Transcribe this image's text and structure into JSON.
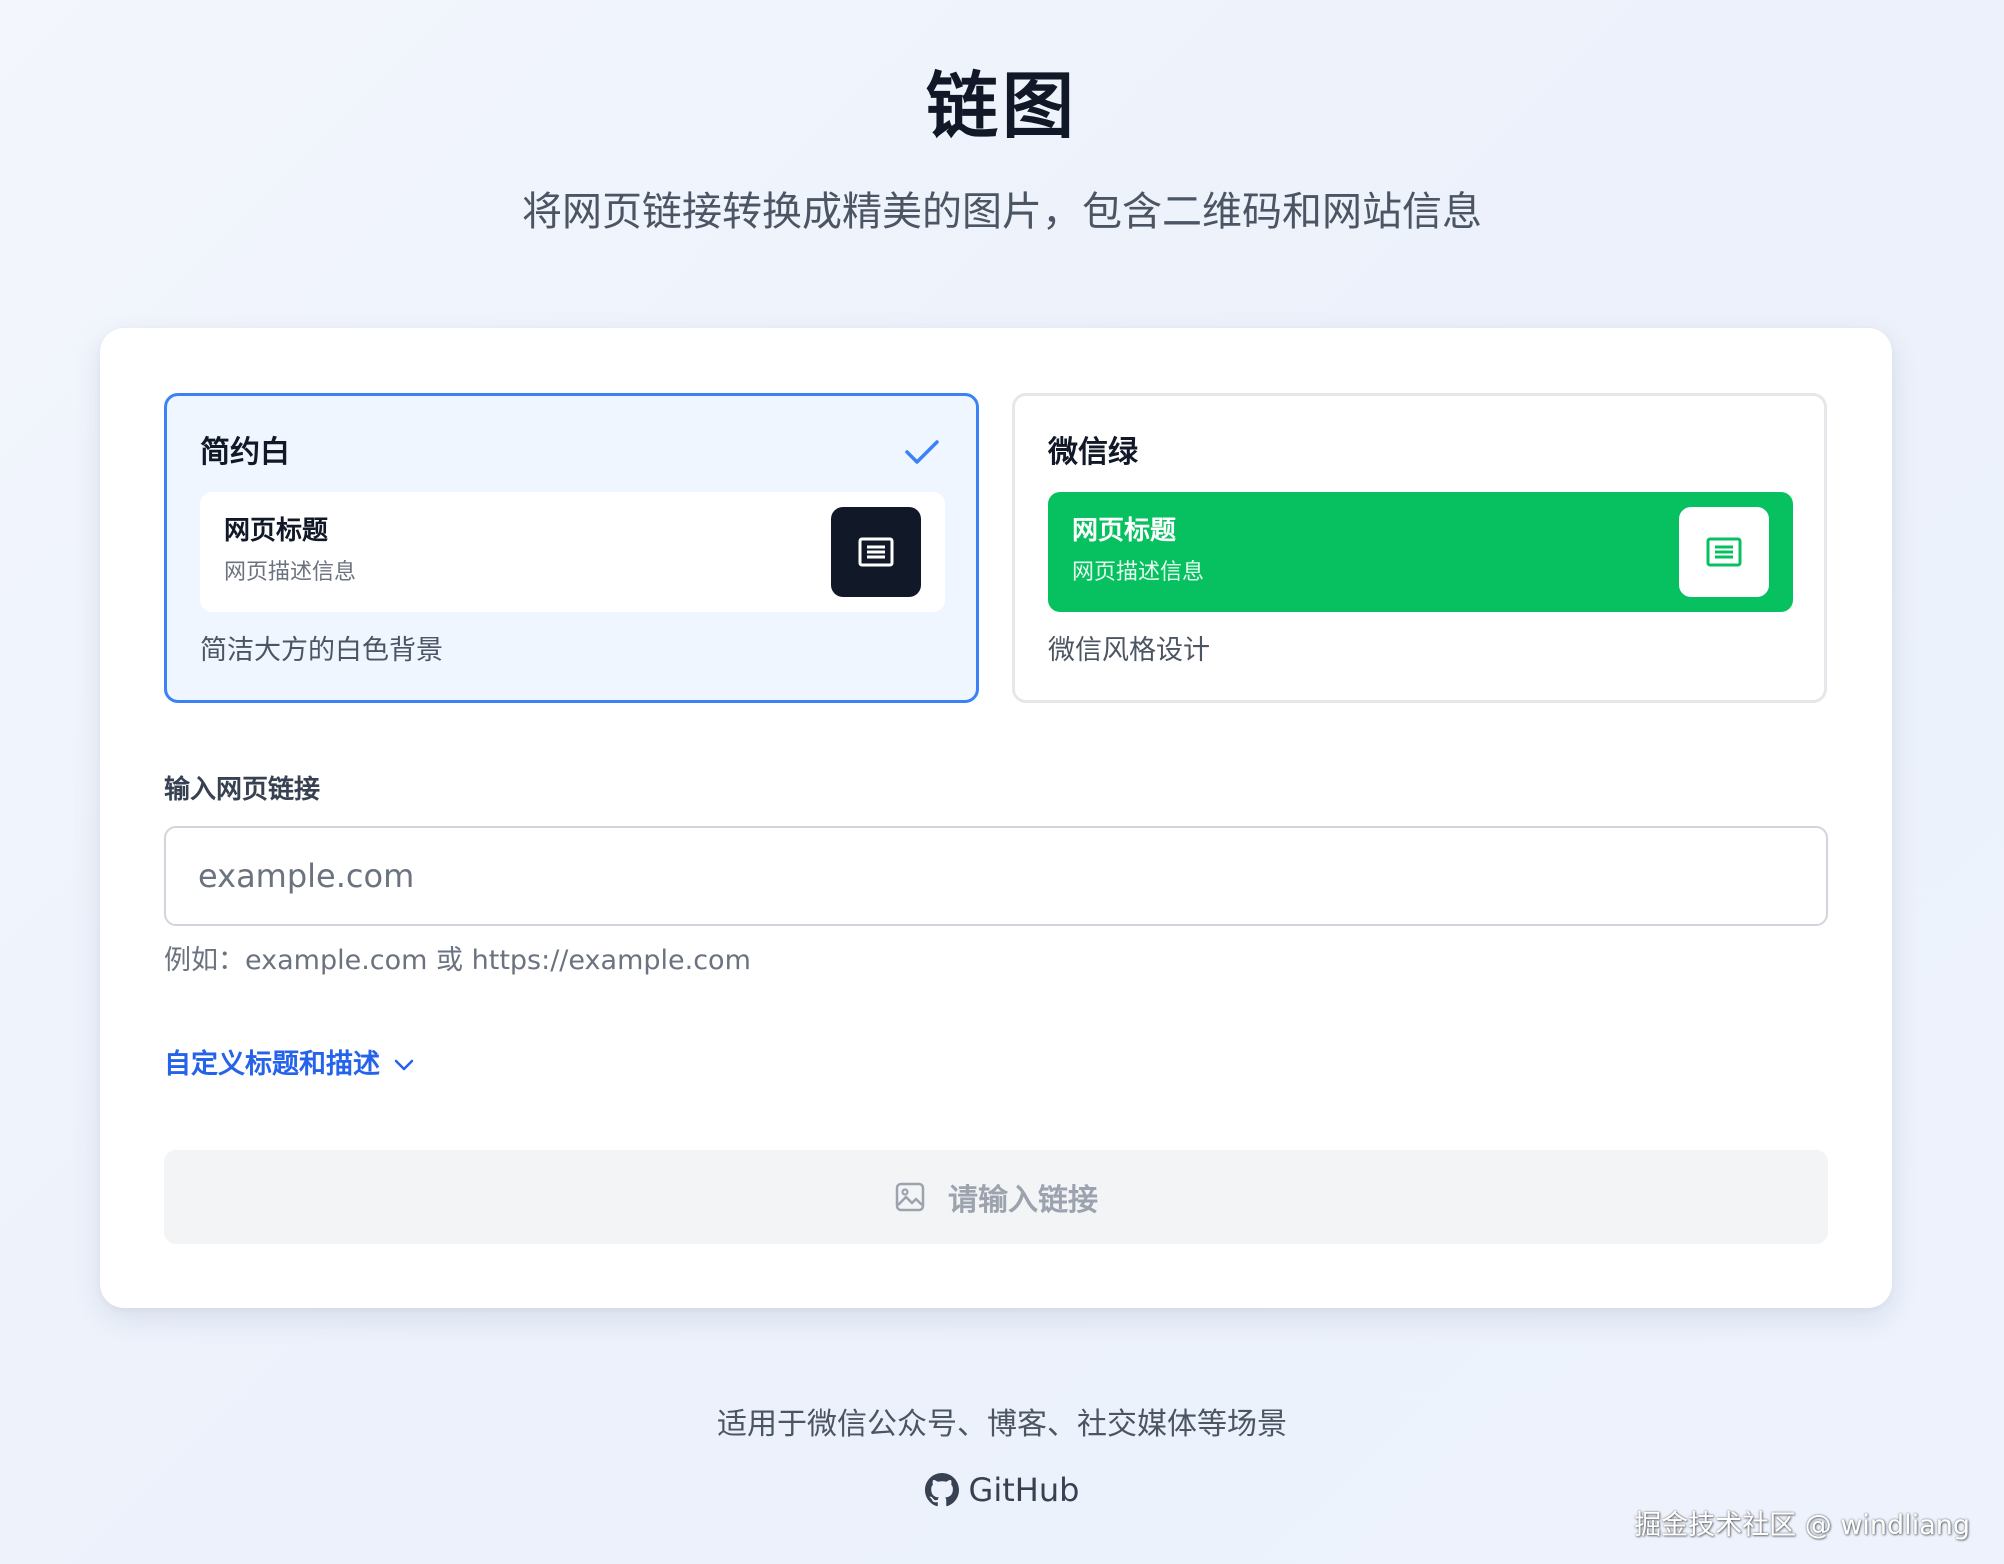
{
  "header": {
    "title": "链图",
    "subtitle": "将网页链接转换成精美的图片，包含二维码和网站信息"
  },
  "themes": [
    {
      "name": "简约白",
      "selected": true,
      "preview_title": "网页标题",
      "preview_desc": "网页描述信息",
      "description": "简洁大方的白色背景",
      "icon": "document-icon"
    },
    {
      "name": "微信绿",
      "selected": false,
      "preview_title": "网页标题",
      "preview_desc": "网页描述信息",
      "description": "微信风格设计",
      "icon": "document-icon"
    }
  ],
  "form": {
    "label": "输入网页链接",
    "value": "",
    "placeholder": "example.com",
    "hint": "例如：example.com 或 https://example.com",
    "customize_label": "自定义标题和描述",
    "submit_label": "请输入链接"
  },
  "footer": {
    "text": "适用于微信公众号、博客、社交媒体等场景",
    "github_label": "GitHub"
  },
  "watermark": "掘金技术社区 @ windliang",
  "colors": {
    "accent": "#3b82f6",
    "link": "#2563eb",
    "wechat_green": "#07c160",
    "dark": "#111827"
  }
}
